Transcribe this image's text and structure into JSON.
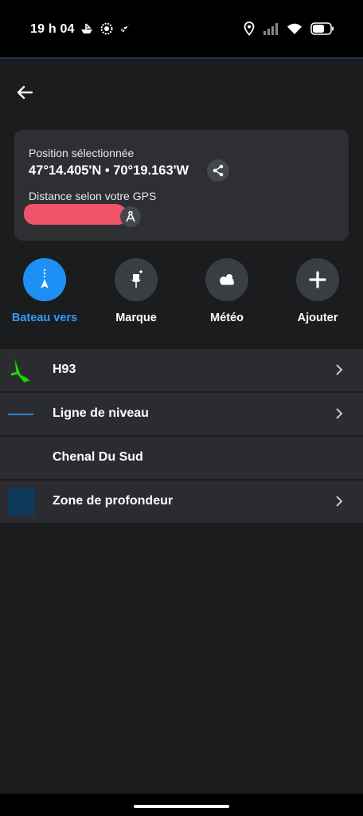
{
  "status_bar": {
    "time": "19 h 04",
    "left_icons": [
      "boat-icon",
      "settings-badge-icon",
      "rocket-icon"
    ],
    "right_icons": [
      "location-icon",
      "signal-icon",
      "wifi-icon",
      "battery-icon"
    ]
  },
  "header": {
    "back_icon": "arrow-left-icon"
  },
  "info_card": {
    "position_label": "Position sélectionnée",
    "coordinates": "47°14.405'N • 70°19.163'W",
    "share_icon": "share-icon",
    "distance_label": "Distance selon votre GPS",
    "distance_redacted": true,
    "compass_icon": "compass-icon"
  },
  "actions": [
    {
      "label": "Bateau vers",
      "icon": "navigate-icon",
      "active": true,
      "color": "#1e90f5"
    },
    {
      "label": "Marque",
      "icon": "pin-icon",
      "active": false
    },
    {
      "label": "Météo",
      "icon": "cloud-icon",
      "active": false
    },
    {
      "label": "Ajouter",
      "icon": "plus-icon",
      "active": false
    }
  ],
  "layers": [
    {
      "label": "H93",
      "icon": "buoy-icon",
      "has_chevron": true
    },
    {
      "label": "Ligne de niveau",
      "icon": "line-icon",
      "has_chevron": true
    },
    {
      "label": "Chenal Du Sud",
      "icon": "",
      "has_chevron": false
    },
    {
      "label": "Zone de profondeur",
      "icon": "depth-zone-icon",
      "has_chevron": true
    }
  ],
  "colors": {
    "accent": "#1e90f5",
    "background": "#1b1c1e",
    "card": "#2d2f33",
    "buoy_green": "#2ecc1a",
    "depth_zone": "#0f3a5c",
    "contour_line": "#2e9bff"
  }
}
